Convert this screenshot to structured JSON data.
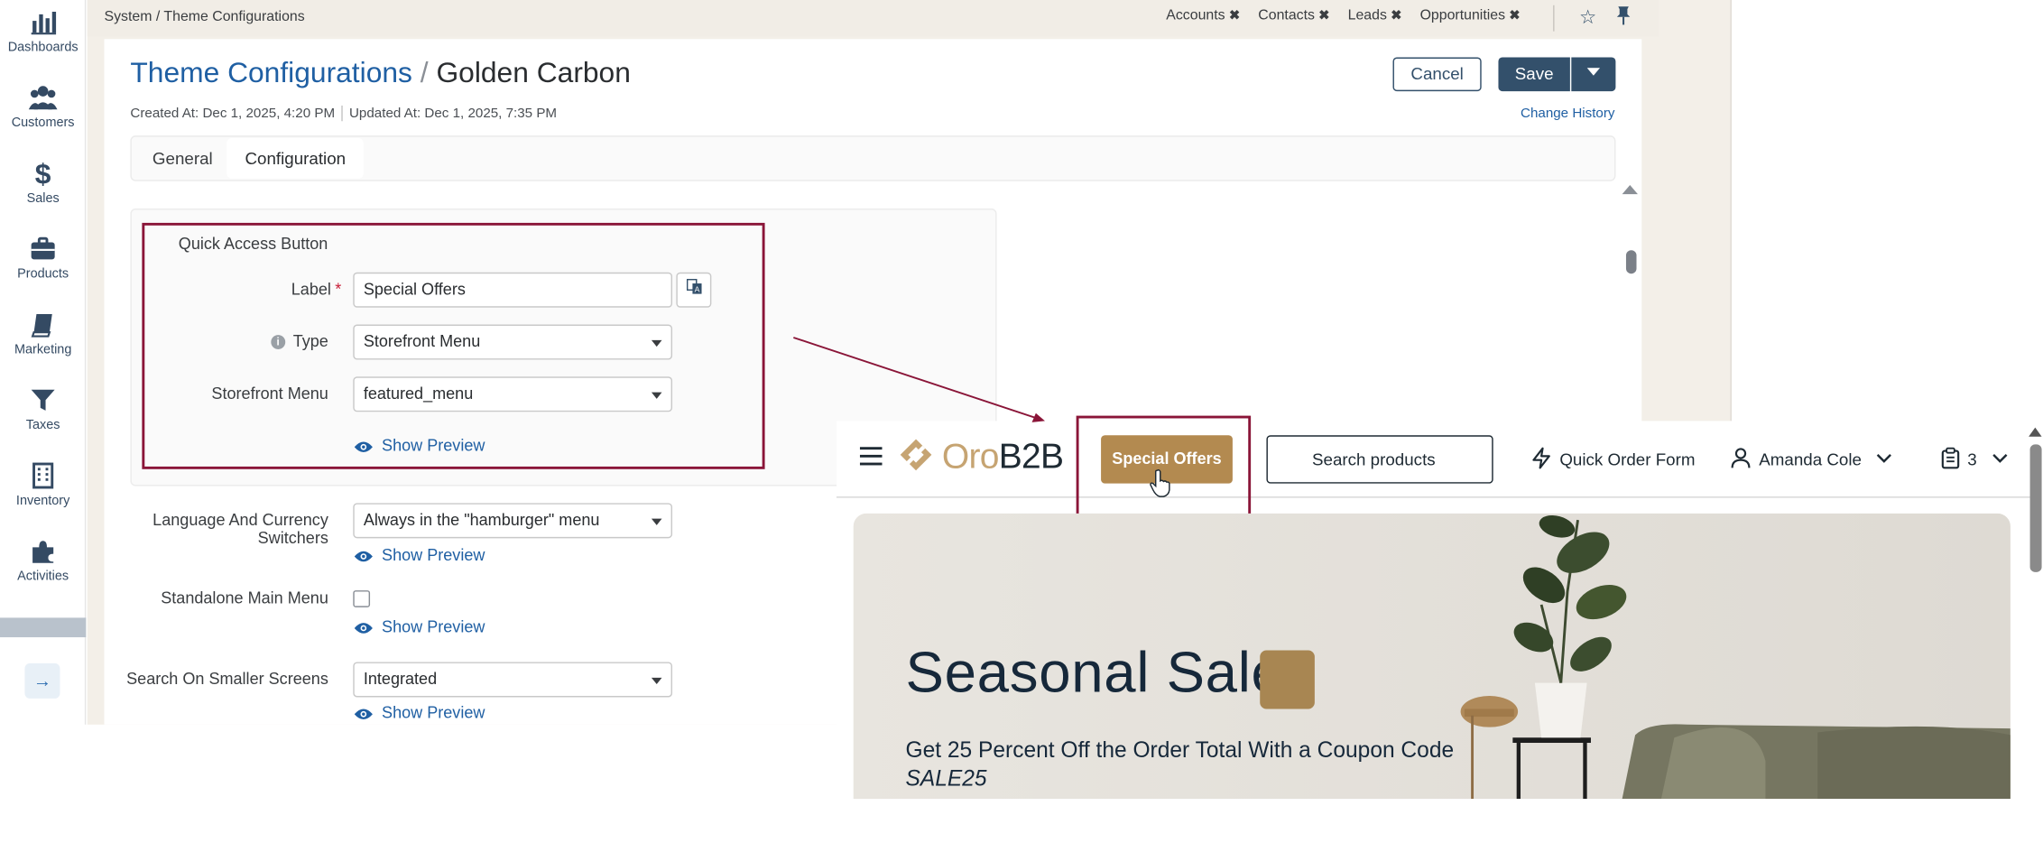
{
  "sidebar": {
    "items": [
      {
        "label": "Dashboards",
        "icon": "bar-chart-icon"
      },
      {
        "label": "Customers",
        "icon": "users-icon"
      },
      {
        "label": "Sales",
        "icon": "dollar-icon"
      },
      {
        "label": "Products",
        "icon": "briefcase-icon"
      },
      {
        "label": "Marketing",
        "icon": "book-icon"
      },
      {
        "label": "Taxes",
        "icon": "filter-icon"
      },
      {
        "label": "Inventory",
        "icon": "building-icon"
      },
      {
        "label": "Activities",
        "icon": "puzzle-icon"
      }
    ],
    "toggle": "→"
  },
  "topbar": {
    "breadcrumb": "System / Theme Configurations",
    "tabs": [
      "Accounts",
      "Contacts",
      "Leads",
      "Opportunities"
    ],
    "close_glyph": "✖"
  },
  "header": {
    "title_crumb": "Theme Configurations",
    "title_slash": "/",
    "title_name": "Golden Carbon",
    "created": "Created At: Dec 1, 2025, 4:20 PM",
    "updated": "Updated At: Dec 1, 2025, 7:35 PM",
    "change_history": "Change History",
    "cancel_label": "Cancel",
    "save_label": "Save"
  },
  "tabs": [
    "General",
    "Configuration"
  ],
  "form": {
    "section_title": "Quick Access Button",
    "label_label": "Label",
    "label_value": "Special Offers",
    "type_label": "Type",
    "type_value": "Storefront Menu",
    "storefront_menu_label": "Storefront Menu",
    "storefront_menu_value": "featured_menu",
    "show_preview": "Show Preview",
    "lang_currency_label_1": "Language And Currency",
    "lang_currency_label_2": "Switchers",
    "lang_currency_value": "Always in the \"hamburger\" menu",
    "standalone_menu_label": "Standalone Main Menu",
    "search_small_label": "Search On Smaller Screens",
    "search_small_value": "Integrated"
  },
  "storefront": {
    "logo_oro": "Oro",
    "logo_b2b": "B2B",
    "special_offers": "Special Offers",
    "search_placeholder": "Search products",
    "quick_order": "Quick Order Form",
    "user_name": "Amanda Cole",
    "cart_count": "3",
    "hero_title": "Seasonal Sale",
    "hero_subtitle": "Get 25 Percent Off the Order Total With a Coupon Code",
    "hero_code": "SALE25"
  },
  "colors": {
    "accent": "#b38a50",
    "highlight_border": "#8a1538",
    "primary_button": "#33506b",
    "link": "#1f5fa3"
  }
}
